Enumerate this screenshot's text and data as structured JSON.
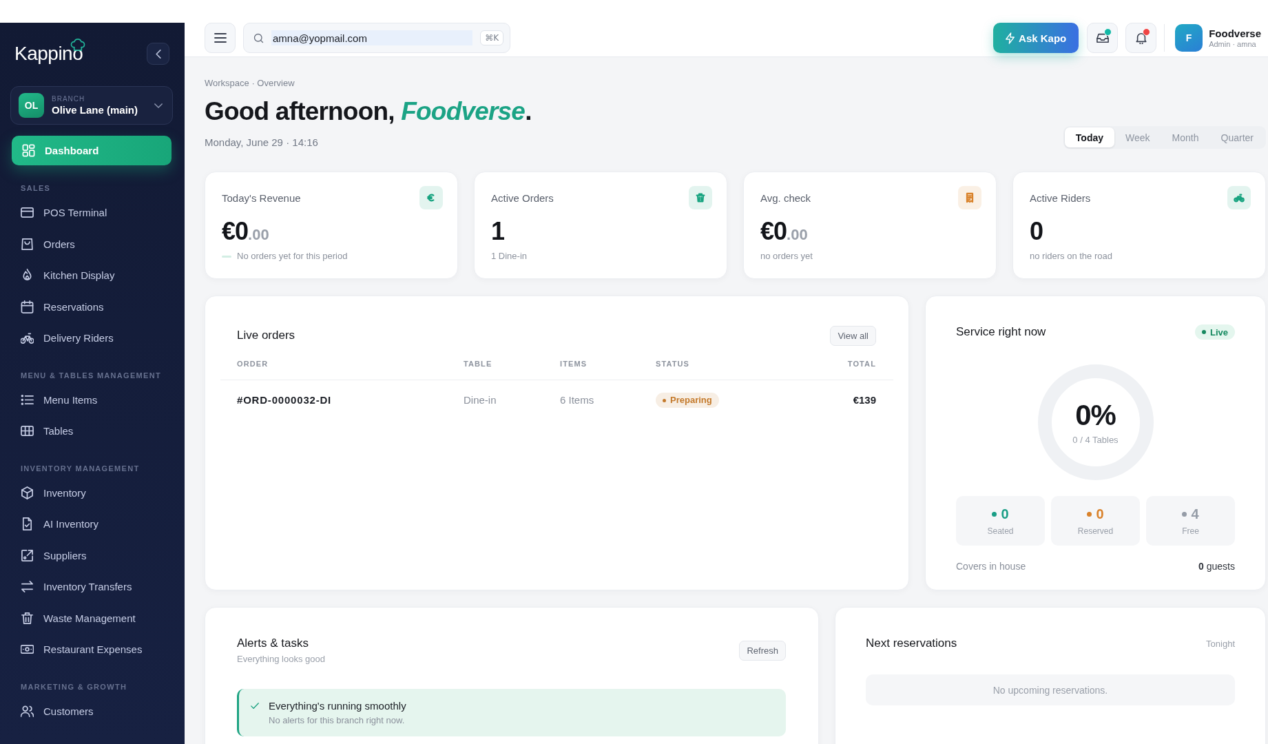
{
  "sidebar": {
    "logo": "Kappino",
    "branch": {
      "initials": "OL",
      "caption": "BRANCH",
      "name": "Olive Lane (main)"
    },
    "nav": [
      {
        "label": "Dashboard",
        "selected": true
      }
    ],
    "sections": [
      {
        "title": "SALES",
        "items": [
          {
            "label": "POS Terminal",
            "selected": false
          },
          {
            "label": "Orders",
            "selected": false
          },
          {
            "label": "Kitchen Display",
            "selected": false
          },
          {
            "label": "Reservations",
            "selected": false
          },
          {
            "label": "Delivery Riders",
            "selected": false
          }
        ]
      },
      {
        "title": "MENU & TABLES MANAGEMENT",
        "items": [
          {
            "label": "Menu Items",
            "selected": false
          },
          {
            "label": "Tables",
            "selected": false
          }
        ]
      },
      {
        "title": "INVENTORY MANAGEMENT",
        "items": [
          {
            "label": "Inventory",
            "selected": false
          },
          {
            "label": "AI Inventory",
            "selected": false
          },
          {
            "label": "Suppliers",
            "selected": false
          },
          {
            "label": "Inventory Transfers",
            "selected": false
          },
          {
            "label": "Waste Management",
            "selected": false
          },
          {
            "label": "Restaurant Expenses",
            "selected": false
          }
        ]
      },
      {
        "title": "MARKETING & GROWTH",
        "items": [
          {
            "label": "Customers",
            "selected": false
          }
        ]
      }
    ]
  },
  "topbar": {
    "search": {
      "value": "amna@yopmail.com",
      "shortcut": "⌘K"
    },
    "ask_button": "Ask Kapo",
    "icon_buttons": [
      {
        "unread": true,
        "color": "#14b8a6"
      },
      {
        "unread": true,
        "color": "#ef4444"
      }
    ],
    "user": {
      "initial": "F",
      "name": "Foodverse",
      "role": "Admin · amna"
    }
  },
  "header": {
    "breadcrumb": "Workspace · Overview",
    "greeting": "Good afternoon, *Foodverse*.",
    "date": "Monday, June 29 · 14:16",
    "periods": [
      {
        "label": "Today",
        "selected": true
      },
      {
        "label": "Week",
        "selected": false
      },
      {
        "label": "Month",
        "selected": false
      },
      {
        "label": "Quarter",
        "selected": false
      }
    ]
  },
  "stats": [
    {
      "label": "Today's Revenue",
      "value": "€0",
      "decimals": ".00",
      "note": "No orders yet for this period",
      "trend": true,
      "color": "#16a37f"
    },
    {
      "label": "Active Orders",
      "value": "1",
      "note": "1 Dine-in",
      "trend": false,
      "color": "#16a37f"
    },
    {
      "label": "Avg. check",
      "value": "€0",
      "decimals": ".00",
      "note": "no orders yet",
      "trend": false,
      "color": "#d9822b"
    },
    {
      "label": "Active Riders",
      "value": "0",
      "note": "no riders on the road",
      "trend": false,
      "color": "#16a37f"
    }
  ],
  "live_orders": {
    "title": "Live orders",
    "action": "View all",
    "columns": [
      "ORDER",
      "TABLE",
      "ITEMS",
      "STATUS",
      "TOTAL"
    ],
    "rows": [
      {
        "order": "#ORD-0000032-DI",
        "table": "Dine-in",
        "items": "6 Items",
        "status": "Preparing",
        "color": "#c47a2c",
        "total": "€139"
      }
    ]
  },
  "service": {
    "title": "Service right now",
    "badge": "Live",
    "percent": "0%",
    "caption": "0 / 4 Tables",
    "stats": [
      {
        "value": "0",
        "label": "Seated",
        "color": "#1a9e86"
      },
      {
        "value": "0",
        "label": "Reserved",
        "color": "#d9822b"
      },
      {
        "value": "4",
        "label": "Free",
        "color": "#959ca7"
      }
    ],
    "covers_label": "Covers in house",
    "covers_value": "**0** guests"
  },
  "alerts": {
    "title": "Alerts & tasks",
    "subtitle": "Everything looks good",
    "action": "Refresh",
    "items": [
      {
        "title": "Everything's running smoothly",
        "text": "No alerts for this branch right now."
      }
    ]
  },
  "reservations": {
    "title": "Next reservations",
    "period": "Tonight",
    "empty": "No upcoming reservations."
  }
}
